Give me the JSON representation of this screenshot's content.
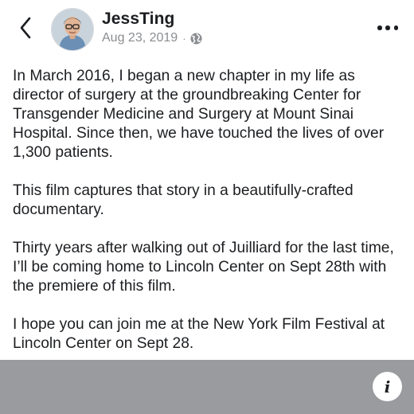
{
  "header": {
    "author_name": "JessTing",
    "post_date": "Aug 23, 2019",
    "separator": "·",
    "back_icon": "chevron-left-icon",
    "privacy_icon": "globe-icon",
    "more_icon": "more-horizontal-icon"
  },
  "post": {
    "paragraphs": [
      "In March 2016, I began a new chapter in my life as director of surgery at the groundbreaking Center for Transgender Medicine and Surgery at Mount Sinai Hospital. Since then, we have touched the lives of over 1,300 patients.",
      "This film captures that story in a beautifully-crafted documentary.",
      "Thirty years after walking out of Juilliard for the last time, I’ll be coming home to Lincoln Center on Sept 28th with the premiere of this film.",
      "I hope you can join me at the New York Film Festival at Lincoln Center on Sept 28."
    ]
  },
  "footer": {
    "info_label": "i",
    "info_icon": "info-icon",
    "bar_color": "#999b9f"
  }
}
